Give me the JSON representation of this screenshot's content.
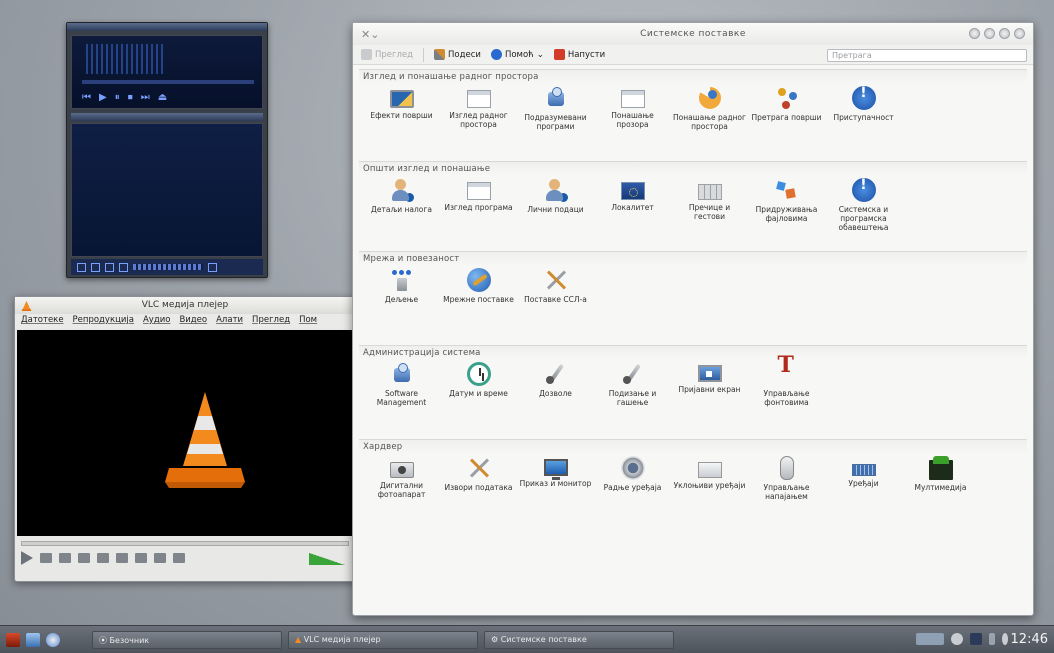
{
  "vlc": {
    "title": "VLC медија плејер",
    "menu": [
      "Датотеке",
      "Репродукција",
      "Аудио",
      "Видео",
      "Алати",
      "Преглед",
      "Пом"
    ]
  },
  "settings": {
    "title": "Системске поставке",
    "toolbar": {
      "overview": "Преглед",
      "configure": "Подеси",
      "help": "Помоћ",
      "quit": "Напусти"
    },
    "search_placeholder": "Претрага",
    "sections": [
      {
        "title": "Изглед и понашање радног простора",
        "items": [
          {
            "label": "Ефекти површи",
            "icon": "effects"
          },
          {
            "label": "Изглед радног простора",
            "icon": "window"
          },
          {
            "label": "Подразумевани програми",
            "icon": "pkg"
          },
          {
            "label": "Понашање прозора",
            "icon": "window"
          },
          {
            "label": "Понашање радног простора",
            "icon": "pacman"
          },
          {
            "label": "Претрага површи",
            "icon": "circles"
          },
          {
            "label": "Приступачност",
            "icon": "info"
          }
        ]
      },
      {
        "title": "Општи изглед и понашање",
        "items": [
          {
            "label": "Детаљи налога",
            "icon": "user"
          },
          {
            "label": "Изглед програма",
            "icon": "window"
          },
          {
            "label": "Лични подаци",
            "icon": "user"
          },
          {
            "label": "Локалитет",
            "icon": "flag"
          },
          {
            "label": "Пречице и гестови",
            "icon": "keys"
          },
          {
            "label": "Придруживања фајловима",
            "icon": "files"
          },
          {
            "label": "Системска и програмска обавештења",
            "icon": "info"
          }
        ]
      },
      {
        "title": "Мрежа и повезаност",
        "items": [
          {
            "label": "Дељење",
            "icon": "share"
          },
          {
            "label": "Мрежне поставке",
            "icon": "globe"
          },
          {
            "label": "Поставке ССЛ-а",
            "icon": "tools"
          }
        ]
      },
      {
        "title": "Администрација система",
        "items": [
          {
            "label": "Software Management",
            "icon": "pkg"
          },
          {
            "label": "Датум и време",
            "icon": "clock"
          },
          {
            "label": "Дозволе",
            "icon": "wrench"
          },
          {
            "label": "Подизање и гашење",
            "icon": "wrench"
          },
          {
            "label": "Пријавни екран",
            "icon": "login"
          },
          {
            "label": "Управљање фонтовима",
            "icon": "font"
          }
        ]
      },
      {
        "title": "Хардвер",
        "items": [
          {
            "label": "Дигитални фотоапарат",
            "icon": "camera"
          },
          {
            "label": "Извори података",
            "icon": "tools"
          },
          {
            "label": "Приказ и монитор",
            "icon": "screen"
          },
          {
            "label": "Радње уређаја",
            "icon": "speaker"
          },
          {
            "label": "Уклоњиви уређаји",
            "icon": "drive"
          },
          {
            "label": "Управљање напајањем",
            "icon": "mouse"
          },
          {
            "label": "Уређаји",
            "icon": "kbd"
          },
          {
            "label": "Мултимедија",
            "icon": "media"
          }
        ]
      }
    ]
  },
  "taskbar": {
    "tasks": [
      "Безочник",
      "VLC медија плејер",
      "Системске поставке"
    ],
    "clock": "12:46"
  },
  "colors": {
    "desktop": "#9ea4ab",
    "taskbar": "#5b6169",
    "vlc_cone": "#f28a1e",
    "info_blue": "#1a5aad"
  }
}
